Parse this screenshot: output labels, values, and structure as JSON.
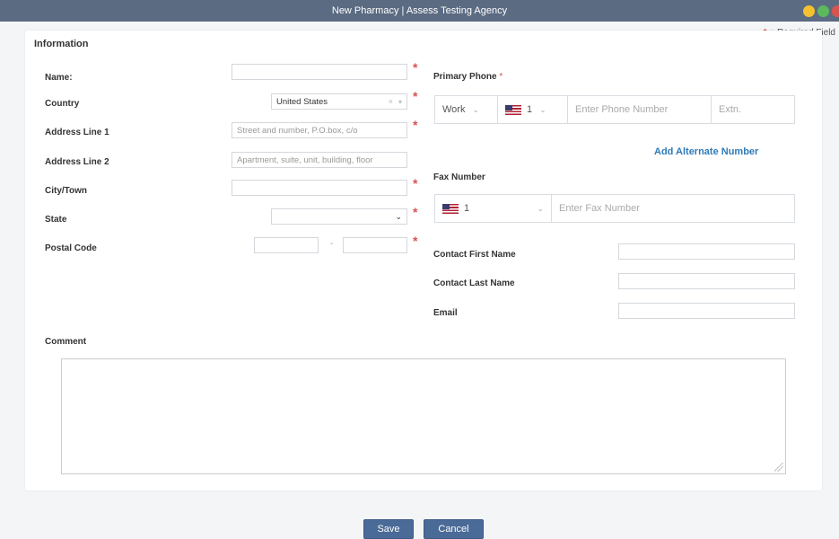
{
  "window": {
    "title": "New Pharmacy | Assess Testing Agency"
  },
  "required_note": {
    "star": "*",
    "text": " = Required Field"
  },
  "section": {
    "information": "Information"
  },
  "address": {
    "name_label": "Name:",
    "name_value": "",
    "country_label": "Country",
    "country_value": "United States",
    "country_clear": "×",
    "country_caret": "▾",
    "address1_label": "Address Line 1",
    "address1_placeholder": "Street and number, P.O.box, c/o",
    "address2_label": "Address Line 2",
    "address2_placeholder": "Apartment, suite, unit, building, floor",
    "city_label": "City/Town",
    "state_label": "State",
    "state_value": "",
    "state_caret": "⌄",
    "postal_label": "Postal Code",
    "postal_dash": "-"
  },
  "phone": {
    "primary_label": "Primary Phone",
    "primary_star": "*",
    "type_value": "Work",
    "type_caret": "⌄",
    "country_code": "1",
    "code_caret": "⌄",
    "number_placeholder": "Enter Phone Number",
    "ext_placeholder": "Extn.",
    "add_alternate": "Add Alternate Number"
  },
  "fax": {
    "label": "Fax Number",
    "country_code": "1",
    "code_caret": "⌄",
    "number_placeholder": "Enter Fax Number"
  },
  "contact": {
    "first_name_label": "Contact First Name",
    "last_name_label": "Contact Last Name",
    "email_label": "Email"
  },
  "comment": {
    "label": "Comment"
  },
  "actions": {
    "save": "Save",
    "cancel": "Cancel"
  },
  "colors": {
    "titlebar": "#5b6b82",
    "required_star": "#d9534f",
    "link": "#2f7ab8",
    "button": "#4a6a97"
  }
}
